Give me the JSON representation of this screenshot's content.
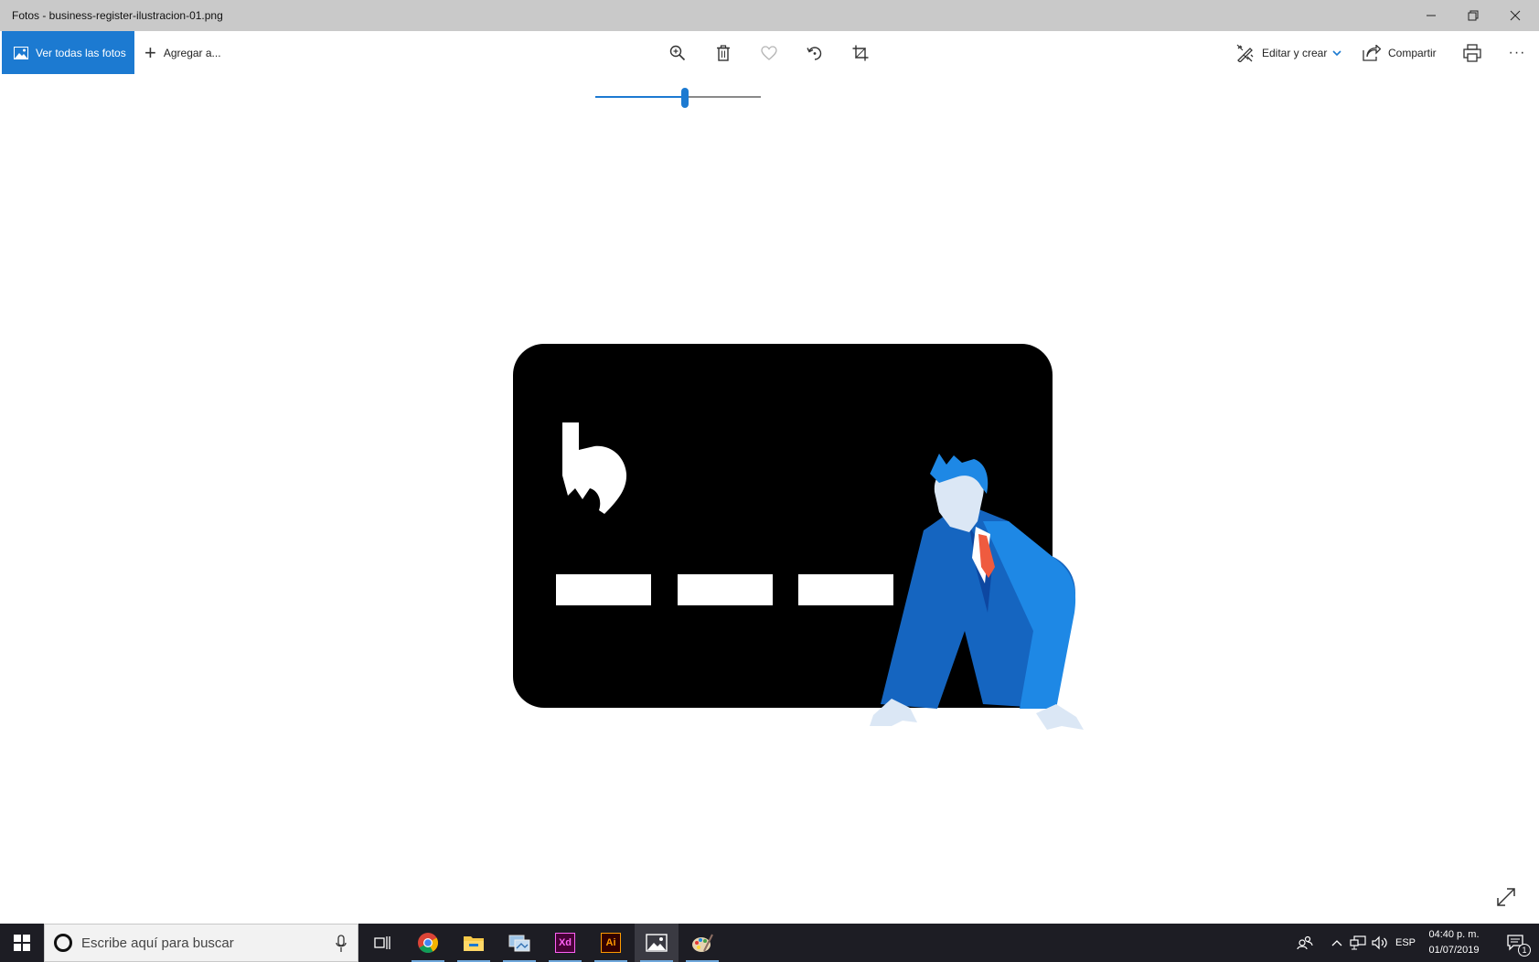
{
  "window": {
    "title": "Fotos - business-register-ilustracion-01.png"
  },
  "toolbar": {
    "all_photos_label": "Ver todas las fotos",
    "add_to_label": "Agregar a...",
    "edit_create_label": "Editar y crear",
    "share_label": "Compartir",
    "more_label": "···"
  },
  "zoom": {
    "level_fraction": 0.54
  },
  "taskbar": {
    "search_placeholder": "Escribe aquí para buscar",
    "apps": [
      "start-icon",
      "task-view-icon",
      "chrome-icon",
      "file-explorer-icon",
      "network-app-icon",
      "adobe-xd-icon",
      "adobe-illustrator-icon",
      "photos-icon",
      "paint-icon"
    ],
    "xd_label": "Xd",
    "ai_label": "Ai",
    "language": "ESP",
    "time": "04:40 p. m.",
    "date": "01/07/2019",
    "notification_count": "1"
  },
  "colors": {
    "accent": "#1c7ad1",
    "titlebar": "#c9c9c9",
    "taskbar": "#1d1d24"
  }
}
